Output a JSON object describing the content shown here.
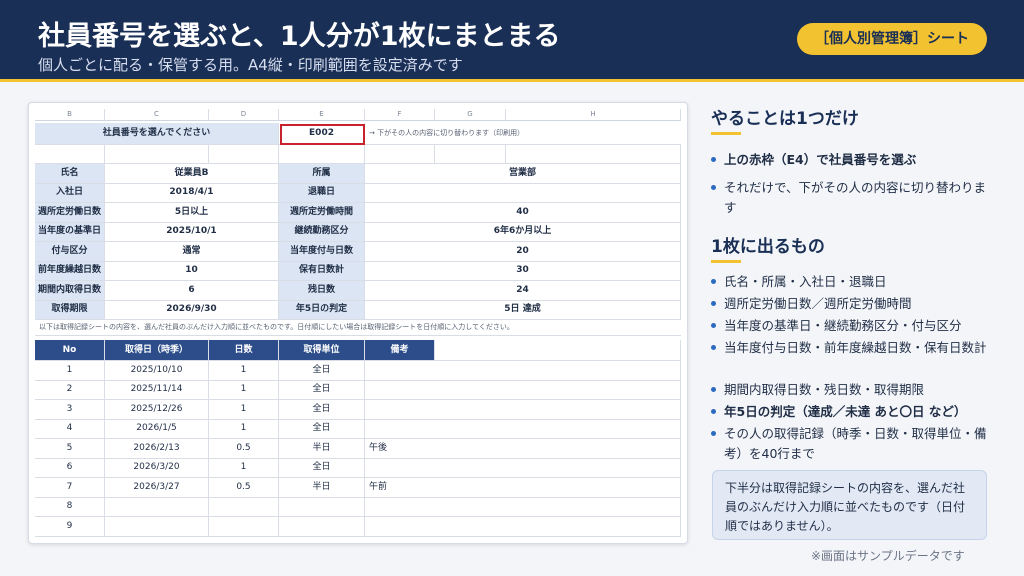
{
  "header": {
    "title": "社員番号を選ぶと、1人分が1枚にまとまる",
    "subtitle": "個人ごとに配る・保管する用。A4縦・印刷範囲を設定済みです",
    "badge": "［個人別管理簿］シート"
  },
  "colors": {
    "navy": "#1a2f55",
    "accent": "#f2c230",
    "label_bg": "#dbe5f4",
    "table_header": "#2c4d8a",
    "selection_border": "#c8232c"
  },
  "sheet": {
    "col_headers": [
      "B",
      "C",
      "D",
      "E",
      "F",
      "G",
      "H"
    ],
    "selector": {
      "prompt": "社員番号を選んでください",
      "value": "E002",
      "hint": "→ 下がその人の内容に切り替わります（印刷用）"
    },
    "info_rows": [
      [
        "氏名",
        "従業員B",
        "所属",
        "営業部"
      ],
      [
        "入社日",
        "2018/4/1",
        "退職日",
        ""
      ],
      [
        "週所定労働日数",
        "5日以上",
        "週所定労働時間",
        "40"
      ],
      [
        "当年度の基準日",
        "2025/10/1",
        "継続勤務区分",
        "6年6か月以上"
      ],
      [
        "付与区分",
        "通常",
        "当年度付与日数",
        "20"
      ],
      [
        "前年度繰越日数",
        "10",
        "保有日数計",
        "30"
      ],
      [
        "期間内取得日数",
        "6",
        "残日数",
        "24"
      ],
      [
        "取得期限",
        "2026/9/30",
        "年5日の判定",
        "5日 達成"
      ]
    ],
    "note": "以下は取得記録シートの内容を、選んだ社員のぶんだけ入力順に並べたものです。日付順にしたい場合は取得記録シートを日付順に入力してください。",
    "record_headers": [
      "No",
      "取得日（時季）",
      "日数",
      "取得単位",
      "備考"
    ],
    "records": [
      [
        "1",
        "2025/10/10",
        "1",
        "全日",
        ""
      ],
      [
        "2",
        "2025/11/14",
        "1",
        "全日",
        ""
      ],
      [
        "3",
        "2025/12/26",
        "1",
        "全日",
        ""
      ],
      [
        "4",
        "2026/1/5",
        "1",
        "全日",
        ""
      ],
      [
        "5",
        "2026/2/13",
        "0.5",
        "半日",
        "午後"
      ],
      [
        "6",
        "2026/3/20",
        "1",
        "全日",
        ""
      ],
      [
        "7",
        "2026/3/27",
        "0.5",
        "半日",
        "午前"
      ],
      [
        "8",
        "",
        "",
        "",
        ""
      ],
      [
        "9",
        "",
        "",
        "",
        ""
      ]
    ]
  },
  "right": {
    "section1_title": "やることは1つだけ",
    "section1_bullets": [
      "上の赤枠（E4）で社員番号を選ぶ",
      "それだけで、下がその人の内容に切り替わります"
    ],
    "section2_title": "1枚に出るもの",
    "section2_bullets": [
      "氏名・所属・入社日・退職日",
      "週所定労働日数／週所定労働時間",
      "当年度の基準日・継続勤務区分・付与区分",
      "当年度付与日数・前年度繰越日数・保有日数計",
      "期間内取得日数・残日数・取得期限",
      "年5日の判定（達成／未達 あと〇日 など）",
      "その人の取得記録（時季・日数・取得単位・備考）を40行まで"
    ],
    "info_box": "下半分は取得記録シートの内容を、選んだ社員のぶんだけ入力順に並べたものです（日付順ではありません）。",
    "footnote": "※画面はサンプルデータです"
  }
}
